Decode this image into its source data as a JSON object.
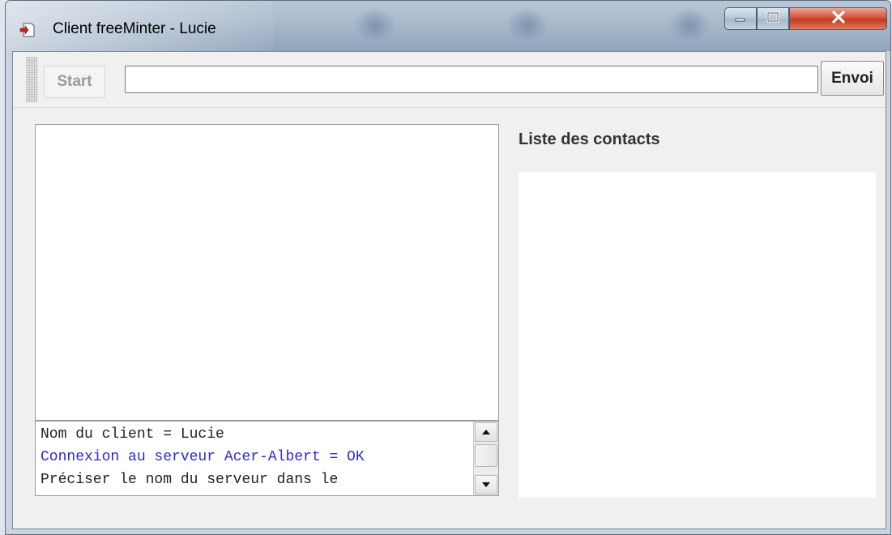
{
  "window": {
    "title": "Client freeMinter - Lucie",
    "app_icon": "document-arrow-icon",
    "controls": {
      "minimize_icon": "minimize-icon",
      "maximize_icon": "maximize-icon",
      "close_icon": "close-icon"
    }
  },
  "toolbar": {
    "start_label": "Start",
    "start_enabled": false,
    "message_value": "",
    "send_label": "Envoi"
  },
  "log": {
    "lines": [
      {
        "text": "Nom du client = Lucie",
        "color": "#222222"
      },
      {
        "text": "Connexion au serveur Acer-Albert = OK",
        "color": "#2b2bd0"
      },
      {
        "text": "Préciser le nom du serveur dans le",
        "color": "#222222"
      }
    ]
  },
  "contacts": {
    "title": "Liste des contacts",
    "items": []
  }
}
